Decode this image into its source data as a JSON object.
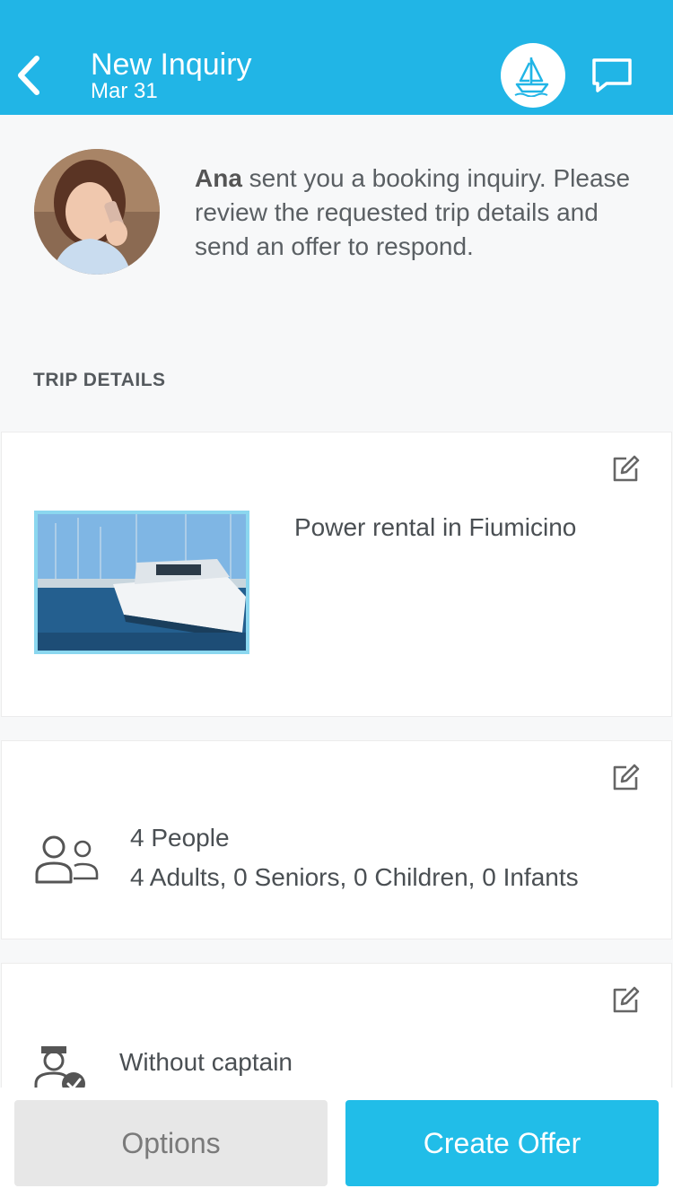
{
  "header": {
    "title": "New Inquiry",
    "date": "Mar 31",
    "back_icon": "chevron-left-icon",
    "boat_icon": "sailboat-icon",
    "chat_icon": "chat-bubble-icon",
    "bg_color": "#21b5e6"
  },
  "intro": {
    "sender": "Ana",
    "text": " sent you a booking inquiry. Please review the requested trip details and send an offer to respond."
  },
  "section": {
    "label": "TRIP DETAILS"
  },
  "cards": {
    "trip": {
      "title": "Power rental in Fiumicino"
    },
    "people": {
      "title": "4 People",
      "detail": "4 Adults, 0 Seniors, 0 Children, 0 Infants"
    },
    "captain": {
      "title": "Without captain"
    }
  },
  "bottom": {
    "options_label": "Options",
    "create_offer_label": "Create Offer",
    "accent_color": "#21bde8"
  }
}
